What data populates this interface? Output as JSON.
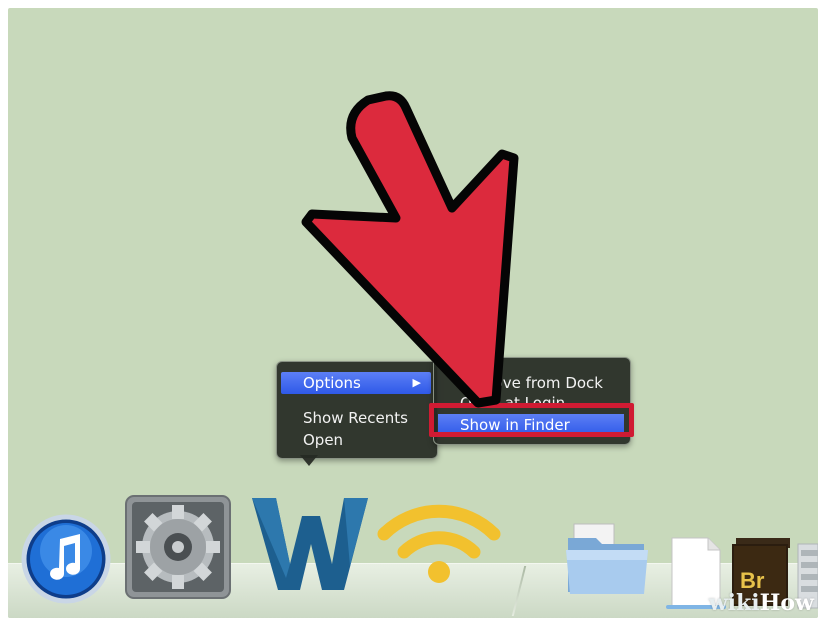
{
  "context_menu": {
    "options_label": "Options",
    "options_arrow": "▶",
    "show_recents_label": "Show Recents",
    "open_label": "Open"
  },
  "submenu": {
    "remove_label": "Remove from Dock",
    "open_at_login_label": "Open at Login",
    "show_in_finder_label": "Show in Finder"
  },
  "dock": {
    "icons": [
      "itunes-icon",
      "system-preferences-icon",
      "word-icon",
      "wifi-icon",
      "folder-icon",
      "document-icon",
      "bridge-icon",
      "stack-icon"
    ],
    "bridge_label": "Br"
  },
  "watermark": {
    "wiki": "wiki",
    "how": "How"
  },
  "colors": {
    "background": "#c8d9bb",
    "arrow_red": "#dc2a3d",
    "highlight_red": "#d01b33",
    "menu_selection": "#3b62ec"
  }
}
